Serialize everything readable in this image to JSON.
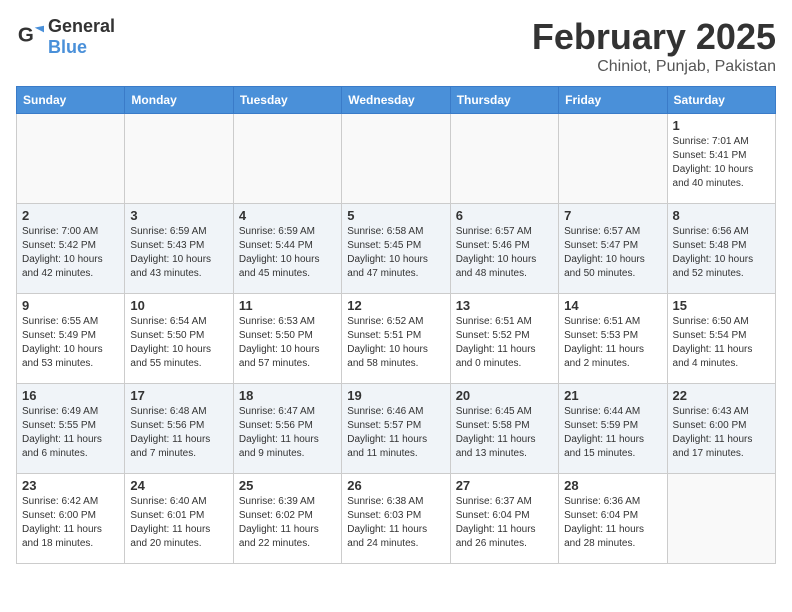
{
  "header": {
    "logo": {
      "general": "General",
      "blue": "Blue"
    },
    "month": "February 2025",
    "location": "Chiniot, Punjab, Pakistan"
  },
  "weekdays": [
    "Sunday",
    "Monday",
    "Tuesday",
    "Wednesday",
    "Thursday",
    "Friday",
    "Saturday"
  ],
  "weeks": [
    [
      {
        "day": "",
        "info": ""
      },
      {
        "day": "",
        "info": ""
      },
      {
        "day": "",
        "info": ""
      },
      {
        "day": "",
        "info": ""
      },
      {
        "day": "",
        "info": ""
      },
      {
        "day": "",
        "info": ""
      },
      {
        "day": "1",
        "info": "Sunrise: 7:01 AM\nSunset: 5:41 PM\nDaylight: 10 hours and 40 minutes."
      }
    ],
    [
      {
        "day": "2",
        "info": "Sunrise: 7:00 AM\nSunset: 5:42 PM\nDaylight: 10 hours and 42 minutes."
      },
      {
        "day": "3",
        "info": "Sunrise: 6:59 AM\nSunset: 5:43 PM\nDaylight: 10 hours and 43 minutes."
      },
      {
        "day": "4",
        "info": "Sunrise: 6:59 AM\nSunset: 5:44 PM\nDaylight: 10 hours and 45 minutes."
      },
      {
        "day": "5",
        "info": "Sunrise: 6:58 AM\nSunset: 5:45 PM\nDaylight: 10 hours and 47 minutes."
      },
      {
        "day": "6",
        "info": "Sunrise: 6:57 AM\nSunset: 5:46 PM\nDaylight: 10 hours and 48 minutes."
      },
      {
        "day": "7",
        "info": "Sunrise: 6:57 AM\nSunset: 5:47 PM\nDaylight: 10 hours and 50 minutes."
      },
      {
        "day": "8",
        "info": "Sunrise: 6:56 AM\nSunset: 5:48 PM\nDaylight: 10 hours and 52 minutes."
      }
    ],
    [
      {
        "day": "9",
        "info": "Sunrise: 6:55 AM\nSunset: 5:49 PM\nDaylight: 10 hours and 53 minutes."
      },
      {
        "day": "10",
        "info": "Sunrise: 6:54 AM\nSunset: 5:50 PM\nDaylight: 10 hours and 55 minutes."
      },
      {
        "day": "11",
        "info": "Sunrise: 6:53 AM\nSunset: 5:50 PM\nDaylight: 10 hours and 57 minutes."
      },
      {
        "day": "12",
        "info": "Sunrise: 6:52 AM\nSunset: 5:51 PM\nDaylight: 10 hours and 58 minutes."
      },
      {
        "day": "13",
        "info": "Sunrise: 6:51 AM\nSunset: 5:52 PM\nDaylight: 11 hours and 0 minutes."
      },
      {
        "day": "14",
        "info": "Sunrise: 6:51 AM\nSunset: 5:53 PM\nDaylight: 11 hours and 2 minutes."
      },
      {
        "day": "15",
        "info": "Sunrise: 6:50 AM\nSunset: 5:54 PM\nDaylight: 11 hours and 4 minutes."
      }
    ],
    [
      {
        "day": "16",
        "info": "Sunrise: 6:49 AM\nSunset: 5:55 PM\nDaylight: 11 hours and 6 minutes."
      },
      {
        "day": "17",
        "info": "Sunrise: 6:48 AM\nSunset: 5:56 PM\nDaylight: 11 hours and 7 minutes."
      },
      {
        "day": "18",
        "info": "Sunrise: 6:47 AM\nSunset: 5:56 PM\nDaylight: 11 hours and 9 minutes."
      },
      {
        "day": "19",
        "info": "Sunrise: 6:46 AM\nSunset: 5:57 PM\nDaylight: 11 hours and 11 minutes."
      },
      {
        "day": "20",
        "info": "Sunrise: 6:45 AM\nSunset: 5:58 PM\nDaylight: 11 hours and 13 minutes."
      },
      {
        "day": "21",
        "info": "Sunrise: 6:44 AM\nSunset: 5:59 PM\nDaylight: 11 hours and 15 minutes."
      },
      {
        "day": "22",
        "info": "Sunrise: 6:43 AM\nSunset: 6:00 PM\nDaylight: 11 hours and 17 minutes."
      }
    ],
    [
      {
        "day": "23",
        "info": "Sunrise: 6:42 AM\nSunset: 6:00 PM\nDaylight: 11 hours and 18 minutes."
      },
      {
        "day": "24",
        "info": "Sunrise: 6:40 AM\nSunset: 6:01 PM\nDaylight: 11 hours and 20 minutes."
      },
      {
        "day": "25",
        "info": "Sunrise: 6:39 AM\nSunset: 6:02 PM\nDaylight: 11 hours and 22 minutes."
      },
      {
        "day": "26",
        "info": "Sunrise: 6:38 AM\nSunset: 6:03 PM\nDaylight: 11 hours and 24 minutes."
      },
      {
        "day": "27",
        "info": "Sunrise: 6:37 AM\nSunset: 6:04 PM\nDaylight: 11 hours and 26 minutes."
      },
      {
        "day": "28",
        "info": "Sunrise: 6:36 AM\nSunset: 6:04 PM\nDaylight: 11 hours and 28 minutes."
      },
      {
        "day": "",
        "info": ""
      }
    ]
  ]
}
